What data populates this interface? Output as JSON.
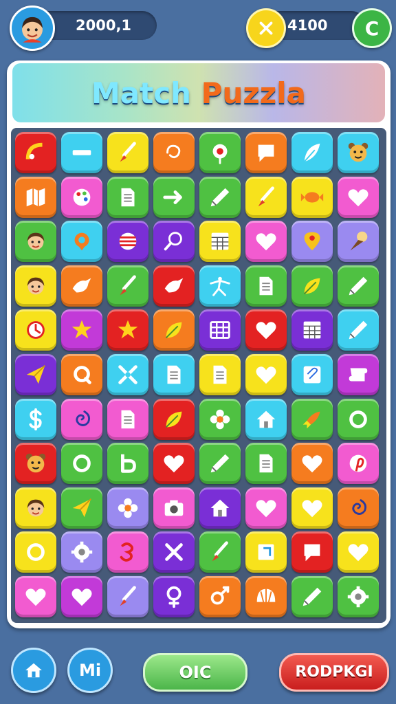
{
  "header": {
    "player_score": "2000,1",
    "coins": "4100",
    "add_button_label": "C"
  },
  "title": {
    "word1": "Match",
    "word2": "Puzzla"
  },
  "footer": {
    "mi_label": "Mi",
    "ok_label": "OIC",
    "red_label": "RODPKGI"
  },
  "colors": {
    "red": "#e32222",
    "cyan": "#3fd0f0",
    "yellow": "#f7e21c",
    "orange": "#f57c1f",
    "green": "#4fc142",
    "purple": "#7a2fd6",
    "pink": "#f25bd0",
    "lavender": "#9a8af0",
    "magenta": "#c23ad8"
  },
  "board": {
    "tiles": [
      [
        "red:arc-icon",
        "cyan:minus-icon",
        "yellow:brush-icon",
        "orange:swirl-icon",
        "green:target-icon",
        "orange:chat-bubble-icon",
        "cyan:feather-icon",
        "cyan:bear-face-icon"
      ],
      [
        "orange:map-icon",
        "pink:palette-icon",
        "green:document-icon",
        "green:arrow-right-icon",
        "green:pencil-icon",
        "yellow:brush-icon",
        "yellow:candy-icon",
        "pink:heart-icon"
      ],
      [
        "green:girl-face-icon",
        "cyan:location-ring-icon",
        "purple:striped-ball-icon",
        "purple:magnifier-icon",
        "yellow:calendar-grid-icon",
        "pink:heart-icon",
        "lavender:map-pin-icon",
        "lavender:ice-cream-icon"
      ],
      [
        "yellow:girl-face-icon",
        "orange:bird-icon",
        "green:brush-icon",
        "red:bird-icon",
        "cyan:stick-figure-icon",
        "green:document-icon",
        "green:leaf-icon",
        "green:pencil-icon"
      ],
      [
        "yellow:clock-icon",
        "magenta:star-icon",
        "red:star-icon",
        "orange:leaf-icon",
        "purple:grid-icon",
        "red:heart-icon",
        "purple:calendar-grid-icon",
        "cyan:pencil-icon"
      ],
      [
        "purple:paper-plane-icon",
        "orange:search-icon",
        "cyan:cross-arrows-icon",
        "cyan:document-icon",
        "yellow:document-icon",
        "yellow:heart-icon",
        "cyan:paperclip-icon",
        "magenta:scroll-icon"
      ],
      [
        "cyan:dollar-icon",
        "pink:spiral-icon",
        "pink:document-icon",
        "red:leaf-icon",
        "green:flower-icon",
        "cyan:home-icon",
        "green:rocket-icon",
        "green:ring-icon"
      ],
      [
        "red:bear-face-icon",
        "green:ring-icon",
        "green:letter-b-icon",
        "red:heart-icon",
        "green:pencil-icon",
        "green:document-icon",
        "orange:heart-icon",
        "pink:pinterest-icon"
      ],
      [
        "yellow:girl-face-icon",
        "green:paper-plane-icon",
        "lavender:flower-icon",
        "pink:camera-icon",
        "purple:home-icon",
        "pink:heart-icon",
        "yellow:heart-icon",
        "orange:spiral-icon"
      ],
      [
        "yellow:ring-icon",
        "lavender:gear-icon",
        "pink:smile-icon",
        "purple:close-icon",
        "green:brush-icon",
        "yellow:square-icon",
        "red:chat-bubble-icon",
        "yellow:heart-icon"
      ],
      [
        "pink:heart-icon",
        "magenta:heart-icon",
        "lavender:brush-icon",
        "purple:female-symbol-icon",
        "orange:link-icon",
        "orange:shell-icon",
        "green:pencil-icon",
        "green:gear-icon"
      ]
    ]
  }
}
